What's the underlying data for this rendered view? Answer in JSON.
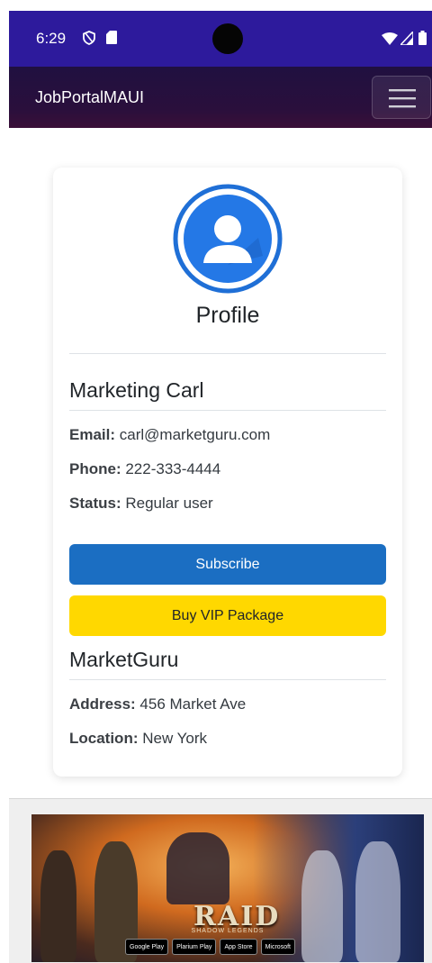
{
  "status_bar": {
    "time": "6:29",
    "icons": [
      "shield-icon",
      "sd-card-icon",
      "wifi-icon",
      "signal-icon",
      "battery-icon"
    ]
  },
  "navbar": {
    "brand": "JobPortalMAUI",
    "toggler_icon": "hamburger-menu-icon"
  },
  "profile": {
    "title": "Profile",
    "avatar_icon": "user-avatar-icon",
    "name": "Marketing Carl",
    "fields": [
      {
        "label": "Email:",
        "value": "carl@marketguru.com"
      },
      {
        "label": "Phone:",
        "value": "222-333-4444"
      },
      {
        "label": "Status:",
        "value": "Regular user"
      }
    ],
    "subscribe_label": "Subscribe",
    "vip_label": "Buy VIP Package"
  },
  "company": {
    "name": "MarketGuru",
    "fields": [
      {
        "label": "Address:",
        "value": "456 Market Ave"
      },
      {
        "label": "Location:",
        "value": "New York"
      }
    ]
  },
  "ad": {
    "logo": "RAID",
    "logo_sub": "SHADOW LEGENDS",
    "badges": [
      "Google Play",
      "Plarium Play",
      "App Store",
      "Microsoft"
    ]
  },
  "colors": {
    "status_bar": "#2d1a9c",
    "primary": "#1b6ec2",
    "vip": "#ffd800"
  }
}
